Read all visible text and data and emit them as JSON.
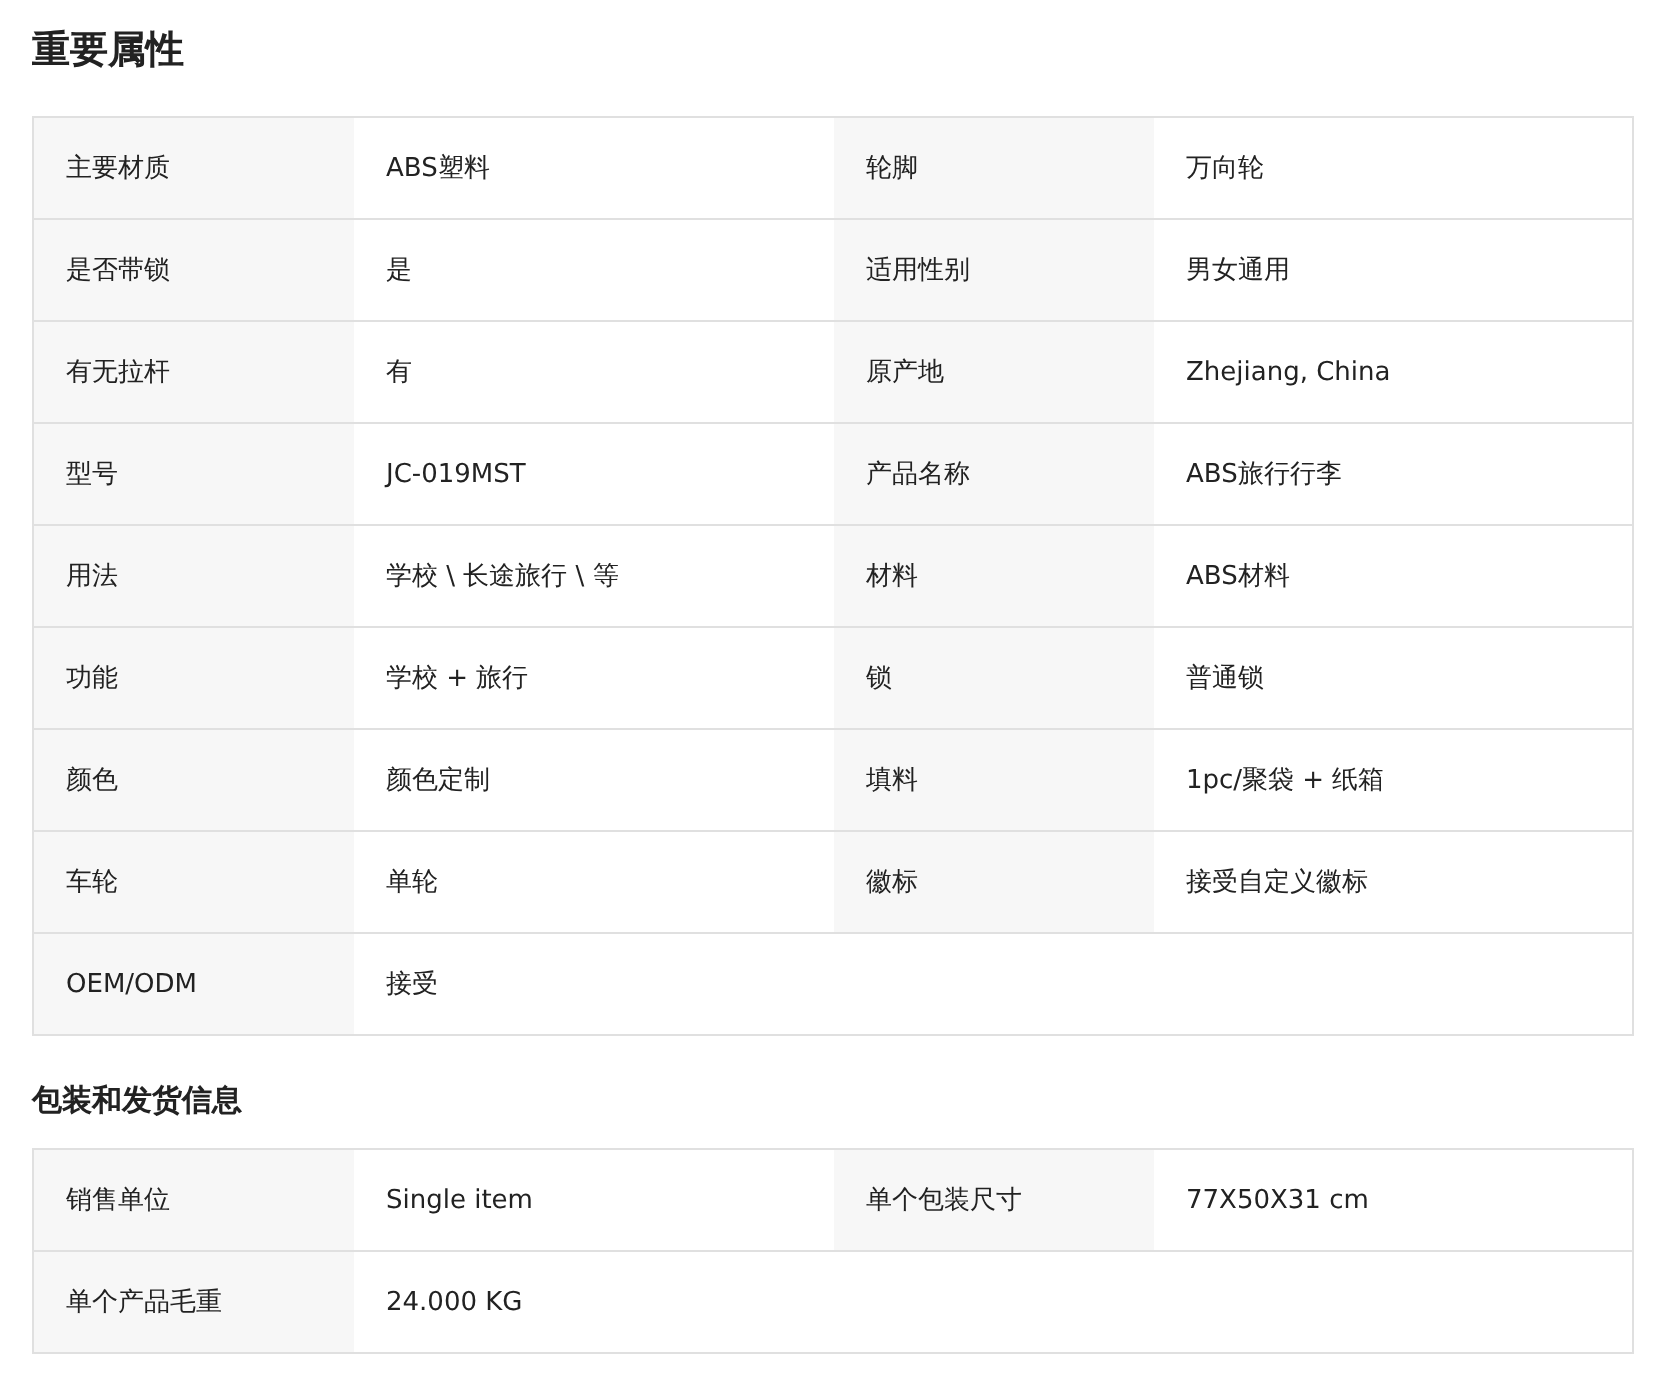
{
  "sections": [
    {
      "title": "重要属性",
      "rows": [
        [
          {
            "label": "主要材质",
            "value": "ABS塑料"
          },
          {
            "label": "轮脚",
            "value": "万向轮"
          }
        ],
        [
          {
            "label": "是否带锁",
            "value": "是"
          },
          {
            "label": "适用性别",
            "value": "男女通用"
          }
        ],
        [
          {
            "label": "有无拉杆",
            "value": "有"
          },
          {
            "label": "原产地",
            "value": "Zhejiang, China"
          }
        ],
        [
          {
            "label": "型号",
            "value": "JC-019MST"
          },
          {
            "label": "产品名称",
            "value": "ABS旅行行李"
          }
        ],
        [
          {
            "label": "用法",
            "value": "学校 \\ 长途旅行 \\ 等"
          },
          {
            "label": "材料",
            "value": "ABS材料"
          }
        ],
        [
          {
            "label": "功能",
            "value": "学校 + 旅行"
          },
          {
            "label": "锁",
            "value": "普通锁"
          }
        ],
        [
          {
            "label": "颜色",
            "value": "颜色定制"
          },
          {
            "label": "填料",
            "value": "1pc/聚袋 + 纸箱"
          }
        ],
        [
          {
            "label": "车轮",
            "value": "单轮"
          },
          {
            "label": "徽标",
            "value": "接受自定义徽标"
          }
        ],
        [
          {
            "label": "OEM/ODM",
            "value": "接受"
          }
        ]
      ]
    },
    {
      "title": "包装和发货信息",
      "rows": [
        [
          {
            "label": "销售单位",
            "value": "Single item"
          },
          {
            "label": "单个包装尺寸",
            "value": "77X50X31 cm"
          }
        ],
        [
          {
            "label": "单个产品毛重",
            "value": "24.000 KG"
          }
        ]
      ]
    }
  ]
}
